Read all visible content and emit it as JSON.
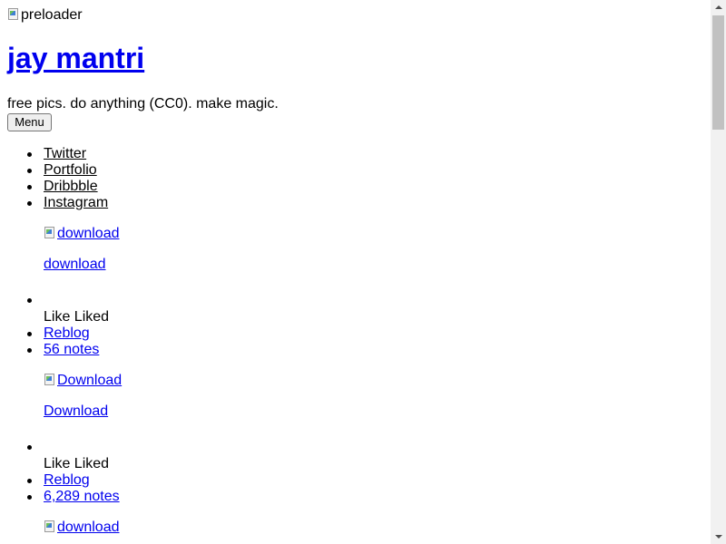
{
  "header": {
    "preloader_alt": "preloader",
    "site_title": "jay mantri",
    "tagline": "free pics. do anything (CC0). make magic.",
    "menu_button": "Menu"
  },
  "social_links": [
    "Twitter",
    "Portfolio",
    "Dribbble",
    "Instagram"
  ],
  "posts": [
    {
      "image_alt": "download",
      "download_link": "download"
    },
    {
      "like_text": "Like Liked",
      "reblog": "Reblog",
      "notes": "56 notes",
      "image_alt": "Download",
      "download_link": "Download"
    },
    {
      "like_text": "Like Liked",
      "reblog": "Reblog",
      "notes": "6,289 notes",
      "image_alt": "download"
    }
  ],
  "colors": {
    "link": "#0000ee",
    "text": "#000000",
    "scrollbar_track": "#f1f1f1",
    "scrollbar_thumb": "#c1c1c1"
  }
}
